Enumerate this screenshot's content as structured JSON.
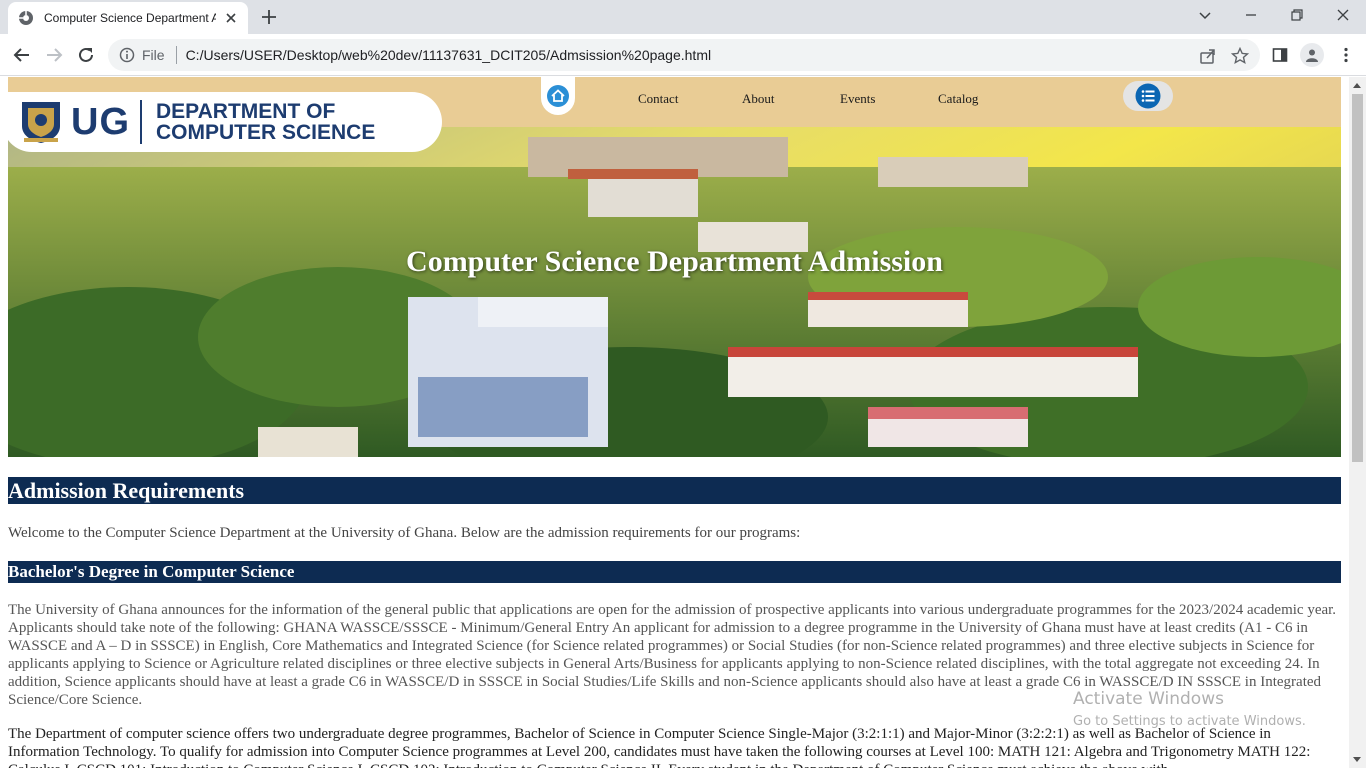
{
  "browser": {
    "tab_title": "Computer Science Department Admission",
    "file_label": "File",
    "url": "C:/Users/USER/Desktop/web%20dev/11137631_DCIT205/Admsission%20page.html"
  },
  "nav": {
    "links": [
      "Contact",
      "About",
      "Events",
      "Catalog"
    ]
  },
  "logo": {
    "ug": "UG",
    "dept_line1": "DEPARTMENT OF",
    "dept_line2": "COMPUTER SCIENCE"
  },
  "hero": {
    "title": "Computer Science Department Admission"
  },
  "content": {
    "heading": "Admission Requirements",
    "intro": "Welcome to the Computer Science Department at the University of Ghana. Below are the admission requirements for our programs:",
    "subheading": "Bachelor's Degree in Computer Science",
    "paragraph1": "The University of Ghana announces for the information of the general public that applications are open for the admission of prospective applicants into various undergraduate programmes for the 2023/2024 academic year. Applicants should take note of the following: GHANA WASSCE/SSSCE - Minimum/General Entry An applicant for admission to a degree programme in the University of Ghana must have at least credits (A1 - C6 in WASSCE and A – D in SSSCE) in English, Core Mathematics and Integrated Science (for Science related programmes) or Social Studies (for non-Science related programmes) and three elective subjects in Science for applicants applying to Science or Agriculture related disciplines or three elective subjects in General Arts/Business for applicants applying to non-Science related disciplines, with the total aggregate not exceeding 24. In addition, Science applicants should have at least a grade C6 in WASSCE/D in SSSCE in Social Studies/Life Skills and non-Science applicants should also have at least a grade C6 in WASSCE/D IN SSSCE in Integrated Science/Core Science.",
    "paragraph2": "The Department of computer science offers two undergraduate degree programmes, Bachelor of Science in Computer Science Single-Major (3:2:1:1) and Major-Minor (3:2:2:1) as well as Bachelor of Science in Information Technology. To qualify for admission into Computer Science programmes at Level 200, candidates must have taken the following courses at Level 100: MATH 121: Algebra and Trigonometry MATH 122: Calculus I, CSCD 101: Introduction to Computer Science I, CSCD 102: Introduction to Computer Science II. Every student in the Department of Computer Science must achieve the above with"
  },
  "watermark": {
    "line1": "Activate Windows",
    "line2": "Go to Settings to activate Windows."
  },
  "colors": {
    "navbar": "#e9cc95",
    "heading_bg": "#0d2b52",
    "logo_blue": "#1d3c70"
  }
}
